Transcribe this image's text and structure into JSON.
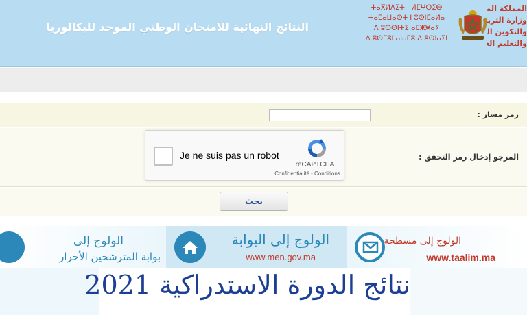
{
  "header": {
    "title": "النتائج النهائية للامتحان الوطني الموحد للبكالوريا",
    "tifinagh_lines": [
      "ⵜⴰⴳⵍⴷⵉⵜ ⵏ ⵍⵎⵖⵔⵉⴱ",
      "ⵜⴰⵎⴰⵡⴰⵙⵜ ⵏ ⵓⵙⵏⵎⴰⵍⴰ",
      "ⴷ ⵓⵙⵙⵏⵜⵉ ⴰⵎⵥⵥⴰⵢ",
      "ⴷ ⵓⵙⵎⵓⵏ ⴰⵏⴰⵎⵓ ⴷ ⵓⵙⵏⴰⵢⵏ"
    ],
    "ministry_lines": [
      "المملكة المغربية",
      "وزارة التربية الوطنية",
      "والتكوين المهني",
      "والتعليم العالي والبحث العلمي"
    ],
    "emblem_icon": "morocco-coat-of-arms-icon"
  },
  "form": {
    "massar_label": "رمز مسار :",
    "massar_value": "",
    "captcha_label": "المرجو إدخال رمز التحقق :",
    "search_label": "بحث"
  },
  "recaptcha": {
    "checkbox_label": "Je ne suis pas un robot",
    "brand": "reCAPTCHA",
    "links": "Confidentialité - Conditions"
  },
  "banner": {
    "tile1_line1": "الولوج إلى",
    "tile1_line2": "بوابة المترشحين الأحرار",
    "tile2_line1": "الولوج إلى البوابة",
    "tile2_line2": "www.men.gov.ma",
    "tile3_line1": "الولوج إلى مسطحة",
    "tile3_line2": "www.taalim.ma"
  },
  "caption": "نتائج الدورة الاستدراكية 2021",
  "colors": {
    "header_bg": "#b8ddf3",
    "accent_blue": "#2b88b8",
    "accent_red": "#c0392b",
    "caption_blue": "#1c3f94"
  }
}
